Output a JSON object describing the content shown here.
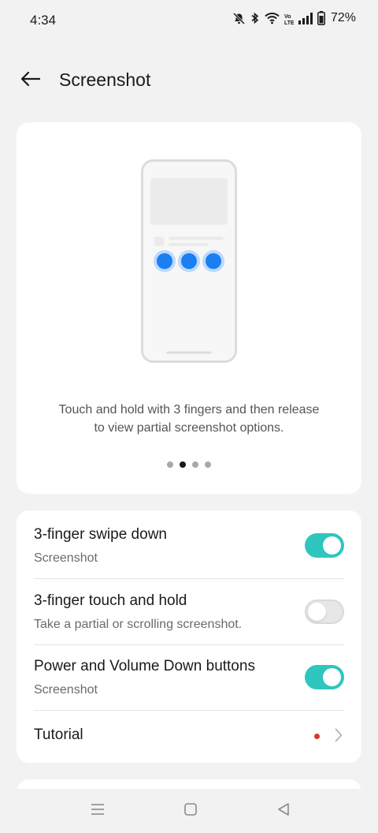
{
  "status_bar": {
    "time": "4:34",
    "battery": "72%",
    "icons": [
      "mute-icon",
      "bluetooth-icon",
      "wifi-icon",
      "volte-icon",
      "signal-icon",
      "battery-icon"
    ]
  },
  "header": {
    "title": "Screenshot",
    "back_icon": "arrow-left-icon"
  },
  "illustration": {
    "caption_line1": "Touch and hold with 3 fingers and then release",
    "caption_line2": "to view partial screenshot options.",
    "page_count": 4,
    "active_page": 1
  },
  "settings": [
    {
      "title": "3-finger swipe down",
      "subtitle": "Screenshot",
      "toggle": true
    },
    {
      "title": "3-finger touch and hold",
      "subtitle": "Take a partial or scrolling screenshot.",
      "toggle": false
    },
    {
      "title": "Power and Volume Down buttons",
      "subtitle": "Screenshot",
      "toggle": true
    },
    {
      "title": "Tutorial",
      "has_badge": true
    }
  ],
  "colors": {
    "accent": "#2ec6bf",
    "badge": "#d23b2f",
    "finger_dot": "#1a7ff0"
  },
  "nav": [
    "menu-icon",
    "home-icon",
    "back-icon"
  ]
}
